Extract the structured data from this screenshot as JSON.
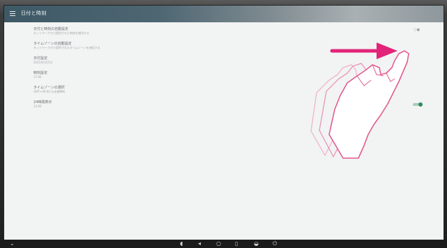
{
  "app": {
    "title": "日付と時刻"
  },
  "settings": {
    "items": [
      {
        "title": "日付と時刻の自動設定",
        "sub": "ネットワークから提供された時刻を使用する"
      },
      {
        "title": "タイムゾーンの自動設定",
        "sub": "ネットワークから提供されたタイムゾーンを使用する"
      },
      {
        "title": "日付設定",
        "sub": "2021年5月5日"
      },
      {
        "title": "時刻設定",
        "sub": "17:06"
      },
      {
        "title": "タイムゾーンの選択",
        "sub": "GMT+09:00 日本標準時"
      },
      {
        "title": "24時間表示",
        "sub": "13:00"
      }
    ],
    "toggle_24h": {
      "state": "on",
      "accent": "#2f8a5f"
    }
  },
  "icons": {
    "menu": "menu-icon",
    "back": "back-icon",
    "home": "home-icon",
    "recent": "recent-apps-icon",
    "volume_down": "volume-down-icon",
    "volume_up": "volume-up-icon",
    "settings": "settings-icon",
    "power": "power-icon",
    "collapse": "chevron-down-icon"
  },
  "colors": {
    "appbar": "#3e5966",
    "gesture_arrow": "#e2237a",
    "hand_outline": "#e25b91"
  }
}
